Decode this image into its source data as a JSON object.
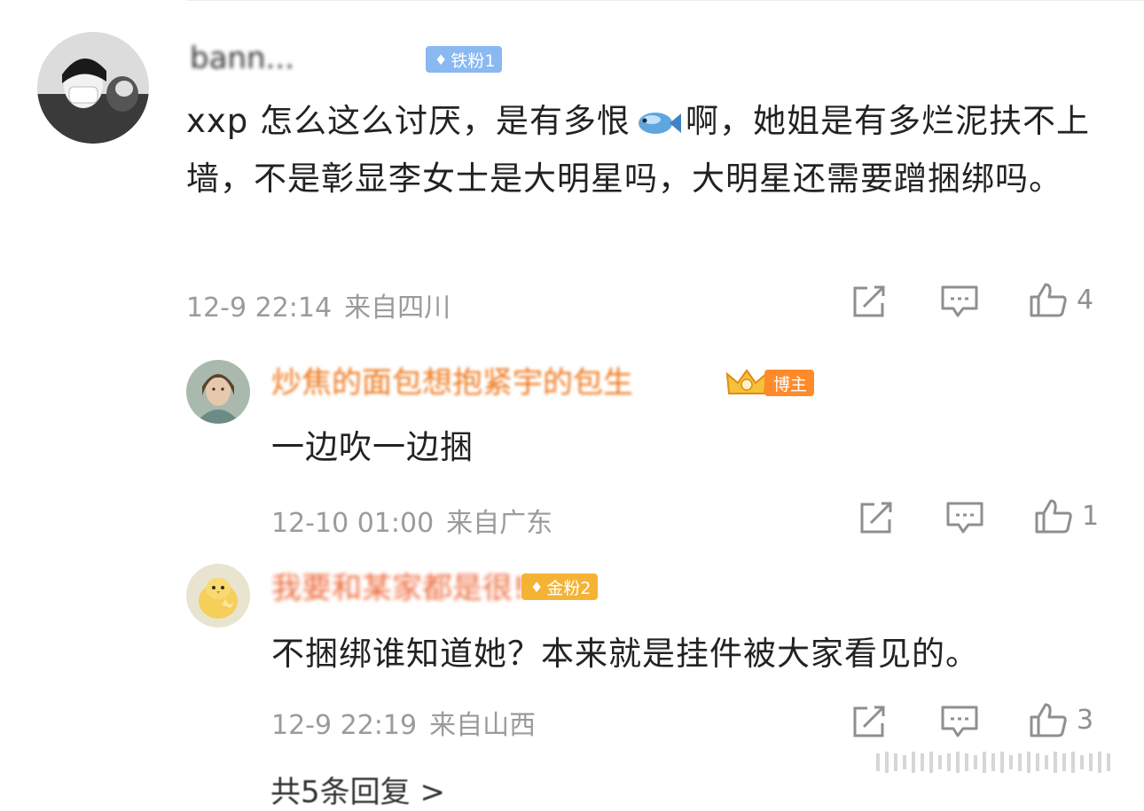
{
  "colors": {
    "meta_text": "#9b9b9b",
    "blogger_name": "#f07a1f",
    "badge_blue": "#8ab8f0",
    "badge_orange": "#ff8a2a",
    "badge_gold": "#f5b335"
  },
  "main_comment": {
    "username": "bann...",
    "badge": "铁粉1",
    "text_before": "xxp 怎么这么讨厌，是有多恨",
    "emoji": "fish-emoji",
    "text_after": "啊，她姐是有多烂泥扶不上墙，不是彰显李女士是大明星吗，大明星还需要蹭捆绑吗。",
    "date": "12-9 22:14",
    "location": "来自四川",
    "likes": "4"
  },
  "replies": [
    {
      "username": "炒焦的面包想抱紧宇的包生",
      "badge": "博主",
      "text": "一边吹一边捆",
      "date": "12-10 01:00",
      "location": "来自广东",
      "likes": "1"
    },
    {
      "username": "我要和某家都是很!",
      "badge": "金粉2",
      "text": "不捆绑谁知道她？本来就是挂件被大家看见的。",
      "date": "12-9 22:19",
      "location": "来自山西",
      "likes": "3"
    }
  ],
  "footer": "共5条回复 >"
}
